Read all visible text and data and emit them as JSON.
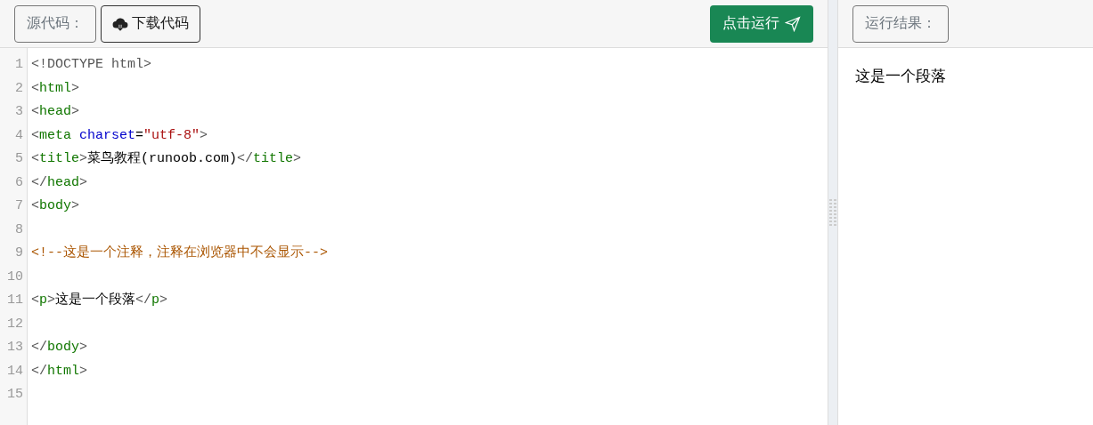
{
  "source_panel": {
    "label": "源代码：",
    "download_button": "下载代码",
    "run_button": "点击运行"
  },
  "code_lines": [
    {
      "number": "1",
      "tokens": [
        {
          "kind": "punct",
          "text": "<!DOCTYPE html>"
        }
      ]
    },
    {
      "number": "2",
      "tokens": [
        {
          "kind": "punct",
          "text": "<"
        },
        {
          "kind": "tag",
          "text": "html"
        },
        {
          "kind": "punct",
          "text": ">"
        }
      ]
    },
    {
      "number": "3",
      "tokens": [
        {
          "kind": "punct",
          "text": "<"
        },
        {
          "kind": "tag",
          "text": "head"
        },
        {
          "kind": "punct",
          "text": ">"
        }
      ]
    },
    {
      "number": "4",
      "tokens": [
        {
          "kind": "punct",
          "text": "<"
        },
        {
          "kind": "tag",
          "text": "meta "
        },
        {
          "kind": "attr",
          "text": "charset"
        },
        {
          "kind": "text",
          "text": "="
        },
        {
          "kind": "string",
          "text": "\"utf-8\""
        },
        {
          "kind": "punct",
          "text": ">"
        }
      ]
    },
    {
      "number": "5",
      "tokens": [
        {
          "kind": "punct",
          "text": "<"
        },
        {
          "kind": "tag",
          "text": "title"
        },
        {
          "kind": "punct",
          "text": ">"
        },
        {
          "kind": "text",
          "text": "菜鸟教程(runoob.com)"
        },
        {
          "kind": "punct",
          "text": "</"
        },
        {
          "kind": "tag",
          "text": "title"
        },
        {
          "kind": "punct",
          "text": ">"
        }
      ]
    },
    {
      "number": "6",
      "tokens": [
        {
          "kind": "punct",
          "text": "</"
        },
        {
          "kind": "tag",
          "text": "head"
        },
        {
          "kind": "punct",
          "text": ">"
        }
      ]
    },
    {
      "number": "7",
      "tokens": [
        {
          "kind": "punct",
          "text": "<"
        },
        {
          "kind": "tag",
          "text": "body"
        },
        {
          "kind": "punct",
          "text": ">"
        }
      ]
    },
    {
      "number": "8"
    },
    {
      "number": "9",
      "tokens": [
        {
          "kind": "comment",
          "text": "<!--这是一个注释，注释在浏览器中不会显示-->"
        }
      ]
    },
    {
      "number": "10"
    },
    {
      "number": "11",
      "tokens": [
        {
          "kind": "punct",
          "text": "<"
        },
        {
          "kind": "tag",
          "text": "p"
        },
        {
          "kind": "punct",
          "text": ">"
        },
        {
          "kind": "text",
          "text": "这是一个段落"
        },
        {
          "kind": "punct",
          "text": "</"
        },
        {
          "kind": "tag",
          "text": "p"
        },
        {
          "kind": "punct",
          "text": ">"
        }
      ]
    },
    {
      "number": "12"
    },
    {
      "number": "13",
      "tokens": [
        {
          "kind": "punct",
          "text": "</"
        },
        {
          "kind": "tag",
          "text": "body"
        },
        {
          "kind": "punct",
          "text": ">"
        }
      ]
    },
    {
      "number": "14",
      "tokens": [
        {
          "kind": "punct",
          "text": "</"
        },
        {
          "kind": "tag",
          "text": "html"
        },
        {
          "kind": "punct",
          "text": ">"
        }
      ]
    },
    {
      "number": "15"
    }
  ],
  "result_panel": {
    "label": "运行结果：",
    "output": "这是一个段落"
  }
}
